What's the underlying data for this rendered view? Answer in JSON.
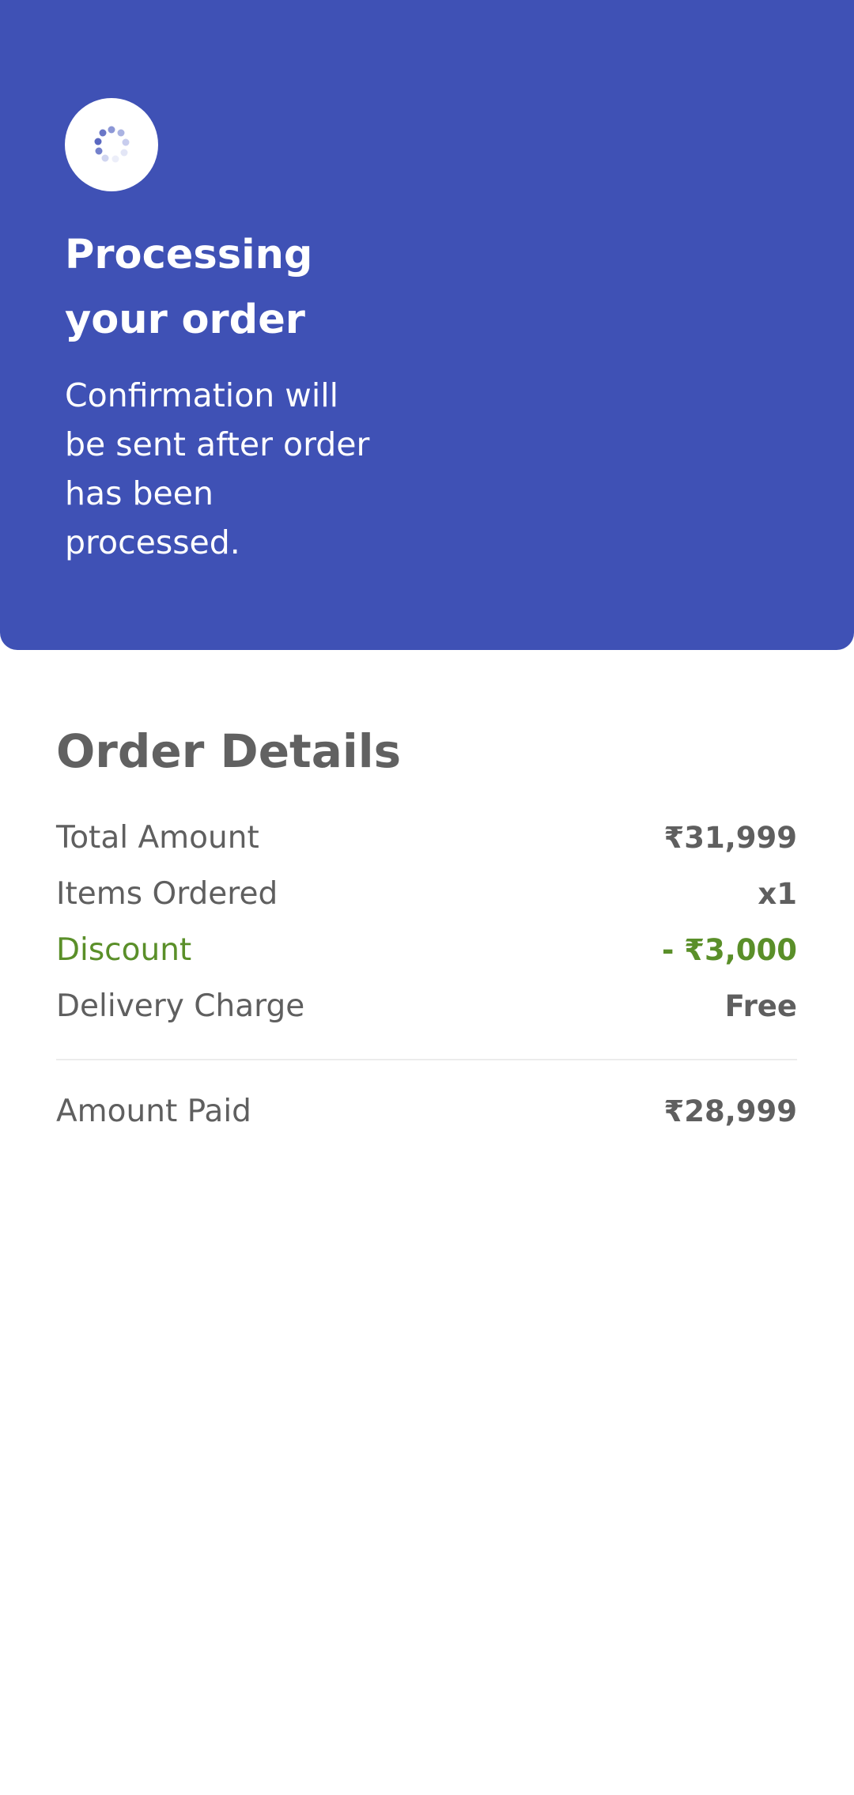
{
  "status": {
    "title": "Processing your order",
    "message": "Confirmation will be sent after order has been processed.",
    "loader_icon": "loading-spinner-icon",
    "accent_color": "#3f51b5"
  },
  "order_details": {
    "heading": "Order Details",
    "rows": [
      {
        "label": "Total Amount",
        "value": "₹31,999"
      },
      {
        "label": "Items Ordered",
        "value": "x1"
      },
      {
        "label": "Discount",
        "value": "- ₹3,000",
        "color": "#5a8f29"
      },
      {
        "label": "Delivery Charge",
        "value": "Free"
      }
    ],
    "amount_paid": {
      "label": "Amount Paid",
      "value": "₹28,999"
    }
  }
}
